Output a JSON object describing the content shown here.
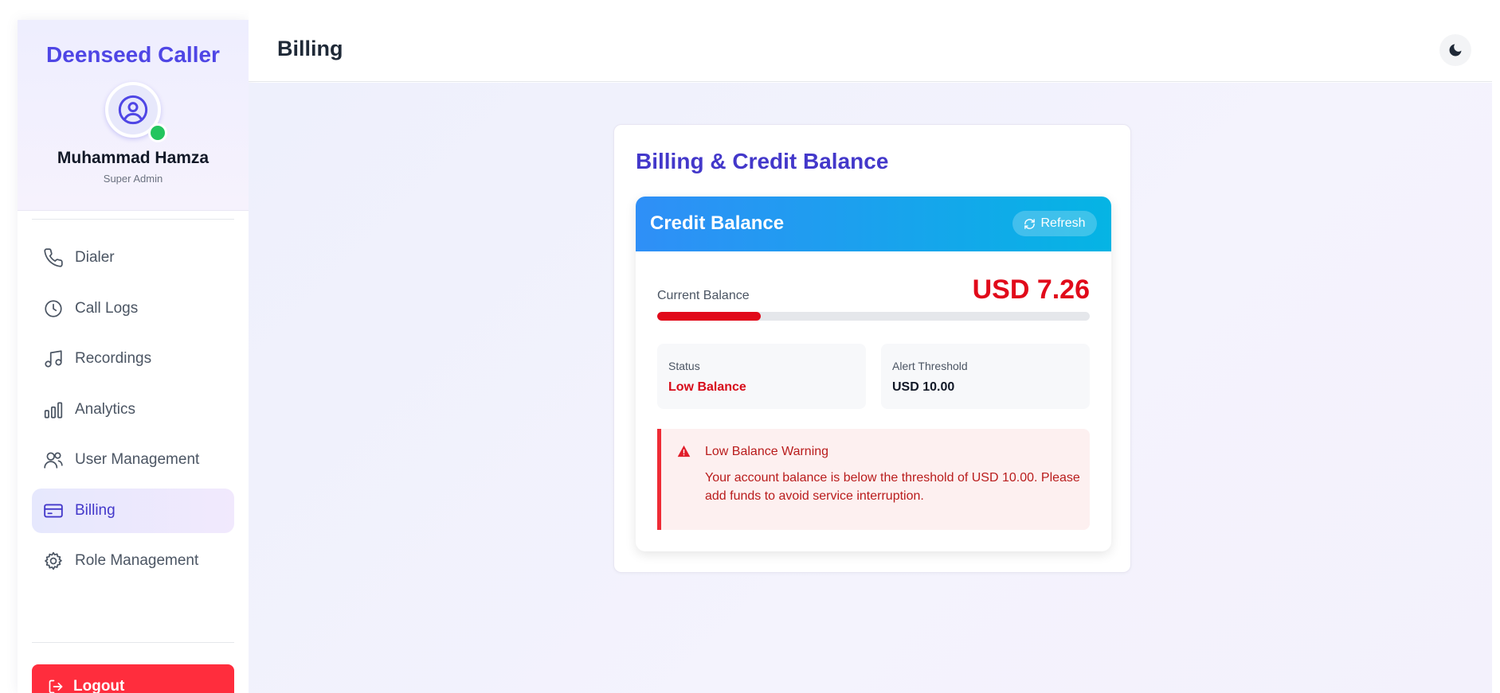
{
  "sidebar": {
    "brand": "Deenseed Caller",
    "user_name": "Muhammad Hamza",
    "user_role": "Super Admin",
    "items": [
      {
        "label": "Dialer",
        "icon": "phone-icon"
      },
      {
        "label": "Call Logs",
        "icon": "clock-icon"
      },
      {
        "label": "Recordings",
        "icon": "music-note-icon"
      },
      {
        "label": "Analytics",
        "icon": "bar-chart-icon"
      },
      {
        "label": "User Management",
        "icon": "users-icon"
      },
      {
        "label": "Billing",
        "icon": "credit-card-icon",
        "active": true
      },
      {
        "label": "Role Management",
        "icon": "gear-icon"
      }
    ],
    "logout_label": "Logout"
  },
  "header": {
    "title": "Billing"
  },
  "billing": {
    "title": "Billing & Credit Balance",
    "card_title": "Credit Balance",
    "refresh_label": "Refresh",
    "current_balance_label": "Current Balance",
    "current_balance_value": "USD 7.26",
    "balance_progress_fraction": 0.24,
    "status_label": "Status",
    "status_value": "Low Balance",
    "threshold_label": "Alert Threshold",
    "threshold_value": "USD 10.00",
    "warning_title": "Low Balance Warning",
    "warning_text": "Your account balance is below the threshold of USD 10.00. Please add funds to avoid service interruption."
  },
  "colors": {
    "accent": "#4f46e5",
    "danger": "#e10a1a",
    "online": "#22c55e",
    "card_header_start": "#2f8ff7",
    "card_header_end": "#05b4e4"
  }
}
